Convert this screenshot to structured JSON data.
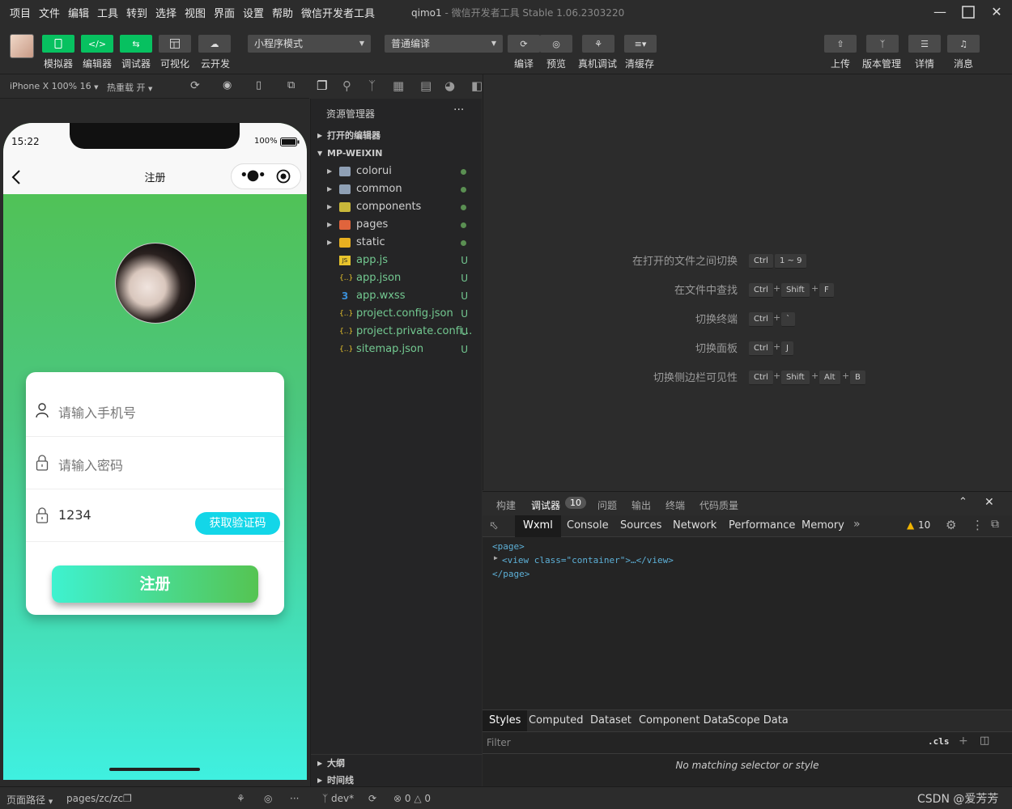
{
  "menu": [
    "项目",
    "文件",
    "编辑",
    "工具",
    "转到",
    "选择",
    "视图",
    "界面",
    "设置",
    "帮助",
    "微信开发者工具"
  ],
  "window": {
    "project": "qimo1",
    "app_title": "- 微信开发者工具 Stable 1.06.2303220"
  },
  "toolbar": {
    "left_buttons": [
      "模拟器",
      "编辑器",
      "调试器",
      "可视化",
      "云开发"
    ],
    "mode_select": "小程序模式",
    "compile_select": "普通编译",
    "mid_buttons": [
      "编译",
      "预览",
      "真机调试",
      "清缓存"
    ],
    "right_buttons": [
      "上传",
      "版本管理",
      "详情",
      "消息"
    ]
  },
  "simbar": {
    "device": "iPhone X 100% 16",
    "hot_reload": "热重载 开"
  },
  "phone": {
    "time": "15:22",
    "battery": "100%",
    "nav_title": "注册",
    "phone_placeholder": "请输入手机号",
    "password_placeholder": "请输入密码",
    "code_value": "1234",
    "code_button": "获取验证码",
    "register_button": "注册"
  },
  "explorer": {
    "title": "资源管理器",
    "open_editors": "打开的编辑器",
    "project": "MP-WEIXIN",
    "folders": [
      {
        "name": "colorui",
        "icon": "folder-icon"
      },
      {
        "name": "common",
        "icon": "folder-icon"
      },
      {
        "name": "components",
        "icon": "folder-components-icon"
      },
      {
        "name": "pages",
        "icon": "folder-pages-icon"
      },
      {
        "name": "static",
        "icon": "folder-static-icon"
      }
    ],
    "files": [
      {
        "name": "app.js",
        "icon": "JS",
        "status": "U"
      },
      {
        "name": "app.json",
        "icon": "{..}",
        "status": "U"
      },
      {
        "name": "app.wxss",
        "icon": "3",
        "status": "U"
      },
      {
        "name": "project.config.json",
        "icon": "{..}",
        "status": "U"
      },
      {
        "name": "project.private.confi...",
        "icon": "{..}",
        "status": "U"
      },
      {
        "name": "sitemap.json",
        "icon": "{..}",
        "status": "U"
      }
    ],
    "outline": "大纲",
    "timeline": "时间线"
  },
  "shortcuts": [
    {
      "label": "在打开的文件之间切换",
      "keys": [
        "Ctrl",
        "1 ~ 9"
      ]
    },
    {
      "label": "在文件中查找",
      "keys": [
        "Ctrl",
        "Shift",
        "F"
      ]
    },
    {
      "label": "切换终端",
      "keys": [
        "Ctrl",
        "`"
      ]
    },
    {
      "label": "切换面板",
      "keys": [
        "Ctrl",
        "J"
      ]
    },
    {
      "label": "切换侧边栏可见性",
      "keys": [
        "Ctrl",
        "Shift",
        "Alt",
        "B"
      ]
    }
  ],
  "devtools": {
    "top_tabs": [
      "构建",
      "调试器",
      "问题",
      "输出",
      "终端",
      "代码质量"
    ],
    "debugger_badge": "10",
    "inner_tabs": [
      "Wxml",
      "Console",
      "Sources",
      "Network",
      "Performance",
      "Memory"
    ],
    "warn_count": "10",
    "code_lines": [
      "<page>",
      "<view class=\"container\">…</view>",
      "</page>"
    ],
    "style_tabs": [
      "Styles",
      "Computed",
      "Dataset",
      "Component Data",
      "Scope Data"
    ],
    "filter_placeholder": "Filter",
    "cls": ".cls",
    "no_match": "No matching selector or style"
  },
  "statusbar": {
    "page_path_label": "页面路径",
    "page_path": "pages/zc/zc",
    "branch": "dev*",
    "errors": "0",
    "warnings": "0",
    "watermark": "CSDN @爱芳芳"
  },
  "colors": {
    "accent_green": "#07c160",
    "code_button": "#13d6e8"
  }
}
